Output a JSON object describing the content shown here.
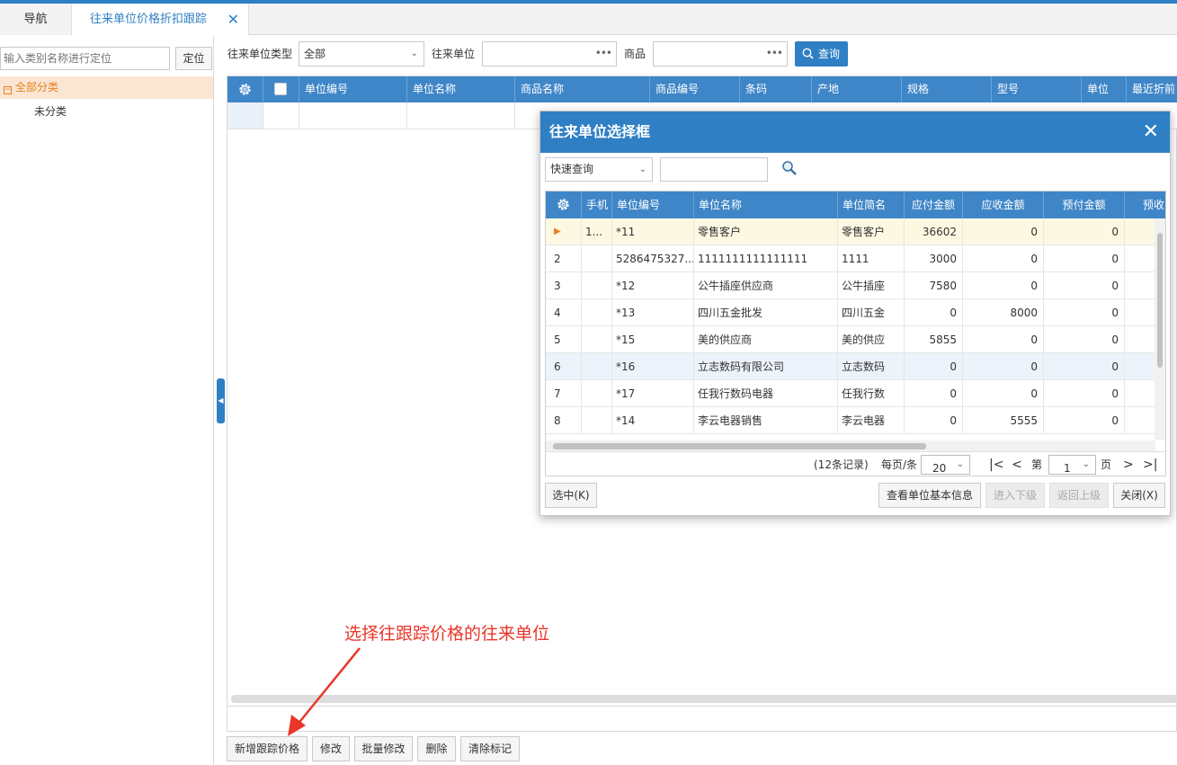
{
  "tabs": {
    "nav": "导航",
    "active": "往来单位价格折扣跟踪"
  },
  "left": {
    "search_placeholder": "输入类别名称进行定位",
    "locate_label": "定位",
    "tree_root": "全部分类",
    "tree_child": "未分类"
  },
  "filter": {
    "type_label": "往来单位类型",
    "type_value": "全部",
    "unit_label": "往来单位",
    "goods_label": "商品",
    "query_label": "查询"
  },
  "grid": {
    "columns": [
      "单位编号",
      "单位名称",
      "商品名称",
      "商品编号",
      "条码",
      "产地",
      "规格",
      "型号",
      "单位",
      "最近折前"
    ]
  },
  "actions": [
    "新增跟踪价格",
    "修改",
    "批量修改",
    "删除",
    "清除标记"
  ],
  "annotation": "选择往跟踪价格的往来单位",
  "dialog": {
    "title": "往来单位选择框",
    "search_mode": "快速查询",
    "columns": [
      "手机",
      "单位编号",
      "单位名称",
      "单位简名",
      "应付金额",
      "应收金额",
      "预付金额",
      "预收"
    ],
    "rows": [
      {
        "idx": "",
        "phone": "1...",
        "code": "*11",
        "name": "零售客户",
        "short": "零售客户",
        "payable": "36602",
        "receivable": "0",
        "prepaid": "0"
      },
      {
        "idx": "2",
        "phone": "",
        "code": "5286475327...",
        "name": "1111111111111111",
        "short": "1111",
        "payable": "3000",
        "receivable": "0",
        "prepaid": "0"
      },
      {
        "idx": "3",
        "phone": "",
        "code": "*12",
        "name": "公牛插座供应商",
        "short": "公牛插座",
        "payable": "7580",
        "receivable": "0",
        "prepaid": "0"
      },
      {
        "idx": "4",
        "phone": "",
        "code": "*13",
        "name": "四川五金批发",
        "short": "四川五金",
        "payable": "0",
        "receivable": "8000",
        "prepaid": "0"
      },
      {
        "idx": "5",
        "phone": "",
        "code": "*15",
        "name": "美的供应商",
        "short": "美的供应",
        "payable": "5855",
        "receivable": "0",
        "prepaid": "0"
      },
      {
        "idx": "6",
        "phone": "",
        "code": "*16",
        "name": "立志数码有限公司",
        "short": "立志数码",
        "payable": "0",
        "receivable": "0",
        "prepaid": "0"
      },
      {
        "idx": "7",
        "phone": "",
        "code": "*17",
        "name": "任我行数码电器",
        "short": "任我行数",
        "payable": "0",
        "receivable": "0",
        "prepaid": "0"
      },
      {
        "idx": "8",
        "phone": "",
        "code": "*14",
        "name": "李云电器销售",
        "short": "李云电器",
        "payable": "0",
        "receivable": "5555",
        "prepaid": "0"
      }
    ],
    "pager": {
      "records": "(12条记录)",
      "per_page_label": "每页/条",
      "per_page": "20",
      "page_prefix": "第",
      "page": "1",
      "page_suffix": "页"
    },
    "buttons": {
      "select": "选中(K)",
      "view_info": "查看单位基本信息",
      "enter_sub": "进入下级",
      "back_up": "返回上级",
      "close": "关闭(X)"
    }
  }
}
